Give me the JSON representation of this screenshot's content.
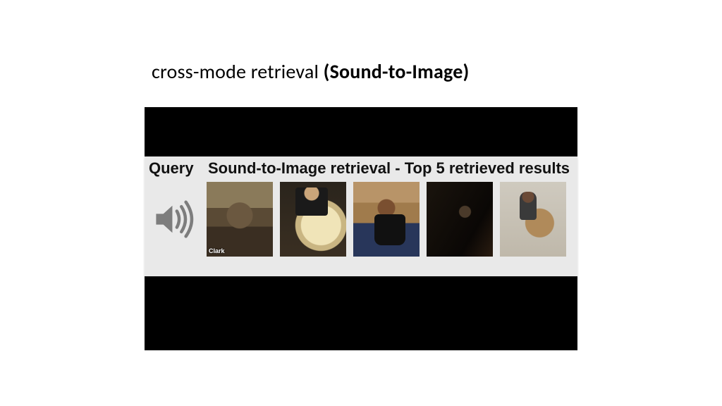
{
  "title": {
    "prefix": "cross-mode retrieval ",
    "bold": "(Sound-to-Image)"
  },
  "panel": {
    "query_label": "Query",
    "results_label": "Sound-to-Image retrieval - Top 5 retrieved results",
    "thumb1_caption": "Clark"
  }
}
